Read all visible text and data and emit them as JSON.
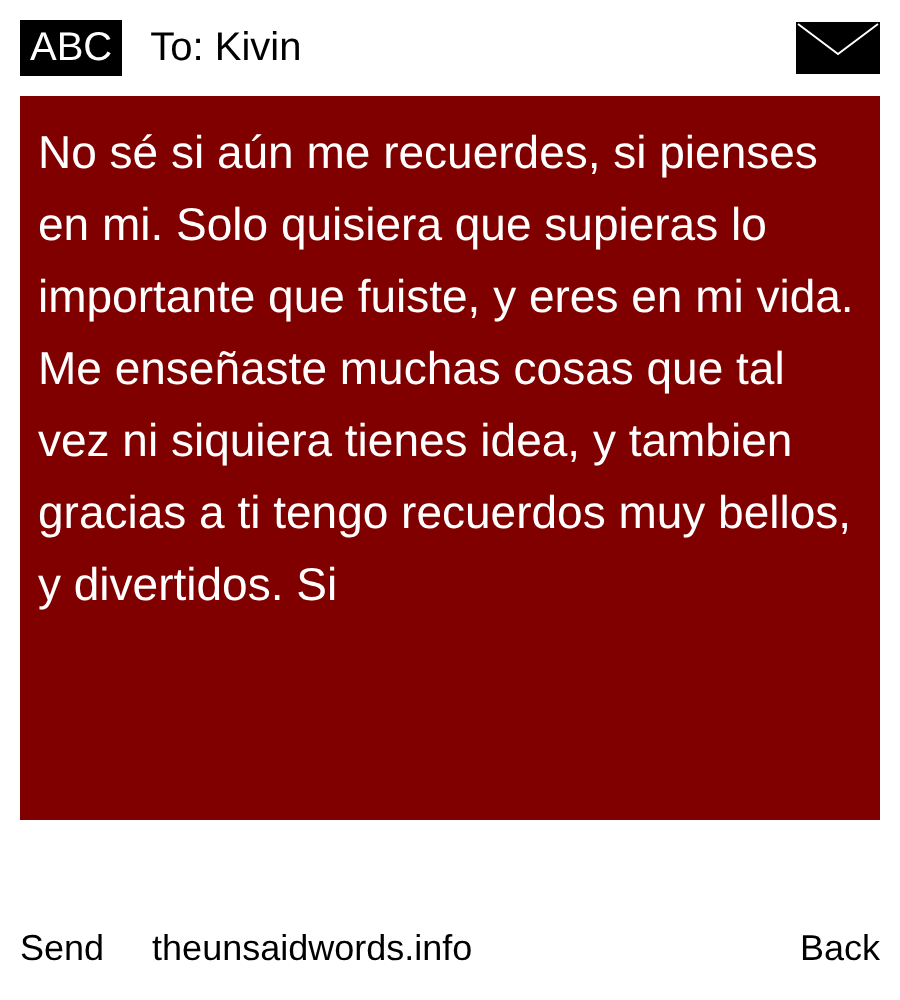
{
  "header": {
    "input_mode": "ABC",
    "recipient": "To: Kivin"
  },
  "message": {
    "text": "No sé si aún me recuerdes, si pienses en mi. Solo quisiera que supieras lo importante que fuiste, y eres en mi vida. Me enseñaste muchas cosas que tal vez ni siquiera tienes idea, y tambien gracias a ti tengo recuerdos muy bellos, y divertidos. Si"
  },
  "footer": {
    "left": "Send",
    "center": "theunsaidwords.info",
    "right": "Back"
  }
}
